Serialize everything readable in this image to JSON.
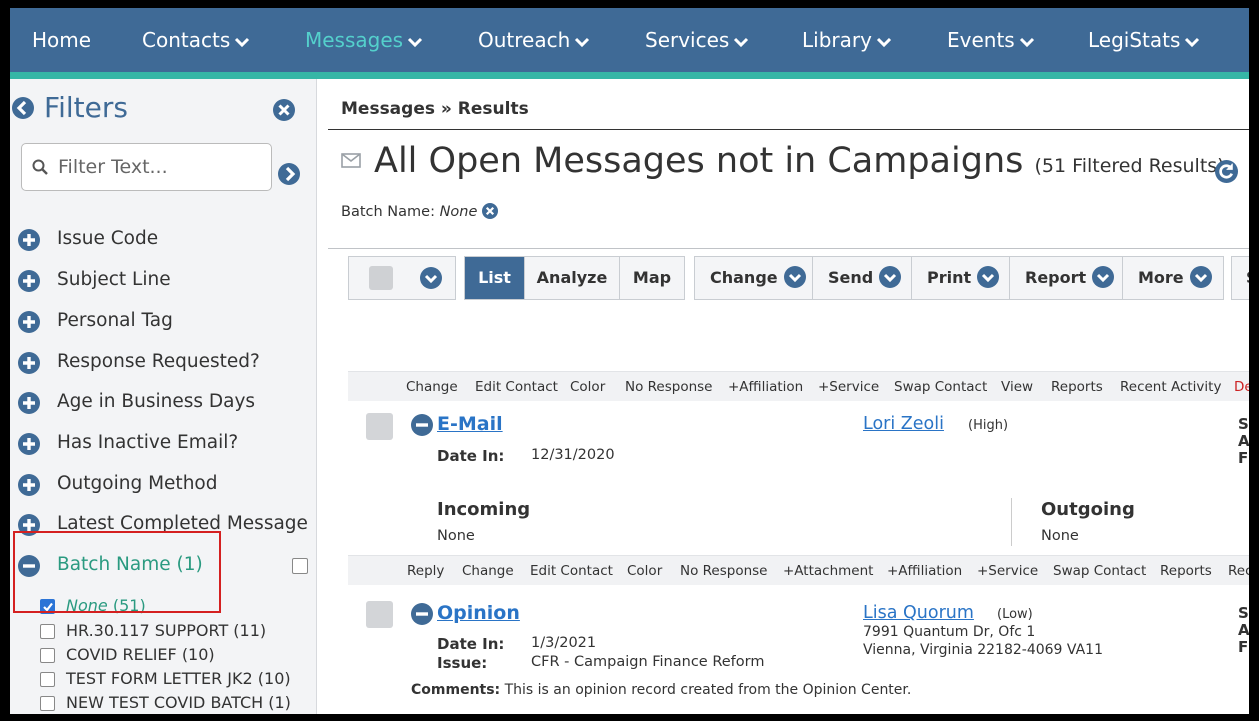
{
  "nav": {
    "items": [
      {
        "label": "Home",
        "chevron": false,
        "active": false
      },
      {
        "label": "Contacts",
        "chevron": true,
        "active": false
      },
      {
        "label": "Messages",
        "chevron": true,
        "active": true
      },
      {
        "label": "Outreach",
        "chevron": true,
        "active": false
      },
      {
        "label": "Services",
        "chevron": true,
        "active": false
      },
      {
        "label": "Library",
        "chevron": true,
        "active": false
      },
      {
        "label": "Events",
        "chevron": true,
        "active": false
      },
      {
        "label": "LegiStats",
        "chevron": true,
        "active": false
      }
    ],
    "bar_color": "#3f6a96",
    "accent_color": "#36b6a6",
    "active_color": "#54d0cc"
  },
  "sidebar": {
    "title": "Filters",
    "filter_placeholder": "Filter Text...",
    "filters": [
      {
        "label": "Issue Code",
        "expanded": false
      },
      {
        "label": "Subject Line",
        "expanded": false
      },
      {
        "label": "Personal Tag",
        "expanded": false
      },
      {
        "label": "Response Requested?",
        "expanded": false
      },
      {
        "label": "Age in Business Days",
        "expanded": false
      },
      {
        "label": "Has Inactive Email?",
        "expanded": false
      },
      {
        "label": "Outgoing Method",
        "expanded": false
      },
      {
        "label": "Latest Completed Message",
        "expanded": false
      },
      {
        "label": "Batch Name (1)",
        "expanded": true
      }
    ],
    "batch_options": [
      {
        "label": "None",
        "count": "(51)",
        "checked": true
      },
      {
        "label": "HR.30.117 SUPPORT (11)",
        "count": "",
        "checked": false
      },
      {
        "label": "COVID RELIEF (10)",
        "count": "",
        "checked": false
      },
      {
        "label": "TEST FORM LETTER JK2 (10)",
        "count": "",
        "checked": false
      },
      {
        "label": "NEW TEST COVID BATCH (1)",
        "count": "",
        "checked": false
      }
    ]
  },
  "main": {
    "breadcrumb": "Messages » Results",
    "title": "All Open Messages not in Campaigns",
    "result_count": "(51 Filtered Results)",
    "batch_label": "Batch Name:",
    "batch_value": "None",
    "toolbar": {
      "view_buttons": [
        "List",
        "Analyze",
        "Map"
      ],
      "action_buttons": [
        "Change",
        "Send",
        "Print",
        "Report",
        "More"
      ],
      "cut_button": "S"
    },
    "records": [
      {
        "actions": [
          "Change",
          "Edit Contact",
          "Color",
          "No Response",
          "+Affiliation",
          "+Service",
          "Swap Contact",
          "View",
          "Reports",
          "Recent Activity",
          "Dele"
        ],
        "type": "E-Mail",
        "date_label": "Date In:",
        "date": "12/31/2020",
        "contact": "Lori Zeoli",
        "priority": "(High)",
        "incoming_label": "Incoming",
        "incoming_value": "None",
        "outgoing_label": "Outgoing",
        "outgoing_value": "None",
        "right_cut": [
          "S",
          "A",
          "F"
        ]
      },
      {
        "actions": [
          "Reply",
          "Change",
          "Edit Contact",
          "Color",
          "No Response",
          "+Attachment",
          "+Affiliation",
          "+Service",
          "Swap Contact",
          "Reports",
          "Rece"
        ],
        "type": "Opinion",
        "date_label": "Date In:",
        "date": "1/3/2021",
        "issue_label": "Issue:",
        "issue": "CFR - Campaign Finance Reform",
        "contact": "Lisa Quorum",
        "priority": "(Low)",
        "address1": "7991 Quantum Dr, Ofc 1",
        "address2": "Vienna, Virginia 22182-4069 VA11",
        "comments_label": "Comments:",
        "comments": "This is an opinion record created from the Opinion Center.",
        "right_cut": [
          "S",
          "A",
          "F"
        ]
      }
    ]
  },
  "colors": {
    "link": "#2a74c6",
    "filter_title": "#3f6a96",
    "expanded_filter": "#2a9a80",
    "highlight_box": "#d42020",
    "checkbox_checked": "#2b74d6"
  }
}
